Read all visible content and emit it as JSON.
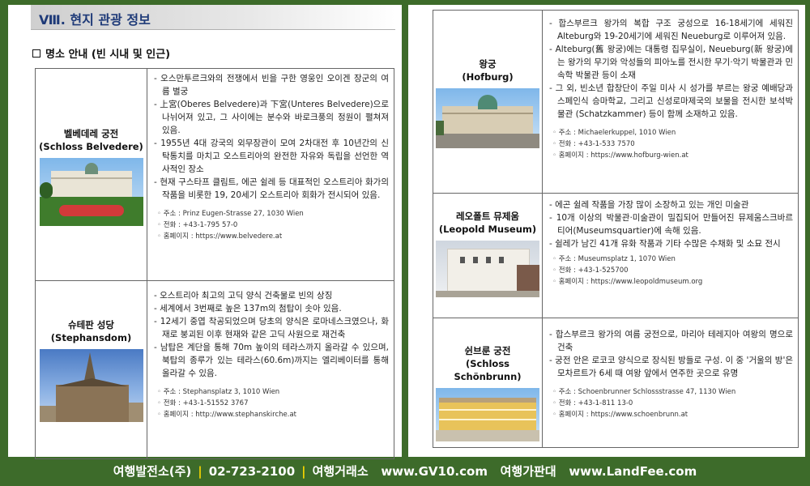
{
  "left_page": {
    "section_title": "Ⅷ. 현지 관광 정보",
    "subheading": "명소 안내 (빈 시내 및 인근)",
    "places": [
      {
        "name_ko": "벨베데레 궁전",
        "name_en": "(Schloss Belvedere)",
        "photo": "belvedere-palace-photo",
        "desc": [
          "오스만투르크와의 전쟁에서 빈을 구한 영웅인 오이겐 장군의 여름 별궁",
          "上宮(Oberes Belvedere)과 下宮(Unteres Belvedere)으로 나뉘어져 있고, 그 사이에는 분수와 바로크풍의 정원이 펼쳐져 있음.",
          "1955년 4대 강국의 외무장관이 모여 2차대전 후 10년간의 신탁통치를 마치고 오스트리아의 완전한 자유와 독립을 선언한 역사적인 장소",
          "현재 구스타프 클림트, 에곤 쉴레 등 대표적인 오스트리아 화가의 작품을 비롯한 19, 20세기 오스트리아 회화가 전시되어 있음."
        ],
        "address": "주소 : Prinz Eugen-Strasse 27, 1030 Wien",
        "phone": "전화 : +43-1-795 57-0",
        "homepage": "홈페이지 : https://www.belvedere.at"
      },
      {
        "name_ko": "슈테판 성당",
        "name_en": "(Stephansdom)",
        "photo": "stephansdom-photo",
        "desc": [
          "오스트리아 최고의 고딕 양식 건축물로 빈의 상징",
          "세계에서 3번째로 높은 137m의 첨탑이 솟아 있음.",
          "12세기 중엽 착공되었으며 당초의 양식은 로마네스크였으나, 화재로 붕괴된 이후 현재와 같은 고딕 사원으로 재건축",
          "남탑은 계단을 통해 70m 높이의 테라스까지 올라갈 수 있으며, 북탑의 종루가 있는 테라스(60.6m)까지는 엘리베이터를 통해 올라갈 수 있음."
        ],
        "address": "주소 : Stephansplatz 3, 1010 Wien",
        "phone": "전화 : +43-1-51552 3767",
        "homepage": "홈페이지 : http://www.stephanskirche.at"
      }
    ]
  },
  "right_page": {
    "places": [
      {
        "name_ko": "왕궁",
        "name_en": "(Hofburg)",
        "photo": "hofburg-photo",
        "desc": [
          "합스부르크 왕가의 복합 구조 궁성으로 16-18세기에 세워진 Alteburg와 19-20세기에 세워진 Neueburg로 이루어져 있음.",
          "Alteburg(舊 왕궁)에는 대통령 집무실이, Neueburg(新 왕궁)에는 왕가의 무기와 악성들의 피아노를 전시한 무기·악기 박물관과 민속학 박물관 등이 소재",
          "그 외, 빈소년 합창단이 주일 미사 시 성가를 부르는 왕궁 예배당과 스페인식 승마학교, 그리고 신성로마제국의 보물을 전시한 보석박물관 (Schatzkammer) 등이 함께 소재하고 있음."
        ],
        "address": "주소 : Michaelerkuppel, 1010 Wien",
        "phone": "전화 : +43-1-533 7570",
        "homepage": "홈페이지 : https://www.hofburg-wien.at"
      },
      {
        "name_ko": "레오폴트 뮤제움",
        "name_en": "(Leopold Museum)",
        "photo": "leopold-museum-photo",
        "desc": [
          "에곤 쉴레 작품을 가장 많이 소장하고 있는 개인 미술관",
          "10개 이상의 박물관·미술관이 밀집되어 만들어진 뮤제움스크바르티어(Museumsquartier)에 속해 있음.",
          "쉴레가 남긴 41개 유화 작품과 기타 수많은 수채화 및 소묘 전시"
        ],
        "address": "주소 : Museumsplatz 1, 1070 Wien",
        "phone": "전화 : +43-1-525700",
        "homepage": "홈페이지 : https://www.leopoldmuseum.org"
      },
      {
        "name_ko": "쉰브룬 궁전",
        "name_en": "(Schloss Schönbrunn)",
        "photo": "schonbrunn-palace-photo",
        "desc": [
          "합스부르크 왕가의 여름 궁전으로, 마리아 테레지아 여왕의 명으로 건축",
          "궁전 안은 로코코 양식으로 장식된 방들로 구성. 이 중 '거울의 방'은 모차르트가 6세 때 여왕 앞에서 연주한 곳으로 유명"
        ],
        "address": "주소 : Schoenbrunner Schlossstrasse 47, 1130 Wien",
        "phone": "전화 : +43-1-811 13-0",
        "homepage": "홈페이지 : https://www.schoenbrunn.at"
      }
    ]
  },
  "footer": {
    "company": "여행발전소(주)",
    "phone": "02-723-2100",
    "exchange_label": "여행거래소",
    "exchange_url": "www.GV10.com",
    "board_label": "여행가판대",
    "board_url": "www.LandFee.com"
  },
  "colors": {
    "background": "#3d6b2a",
    "section_title": "#1e3a78",
    "footer_separator": "#f5d400"
  }
}
